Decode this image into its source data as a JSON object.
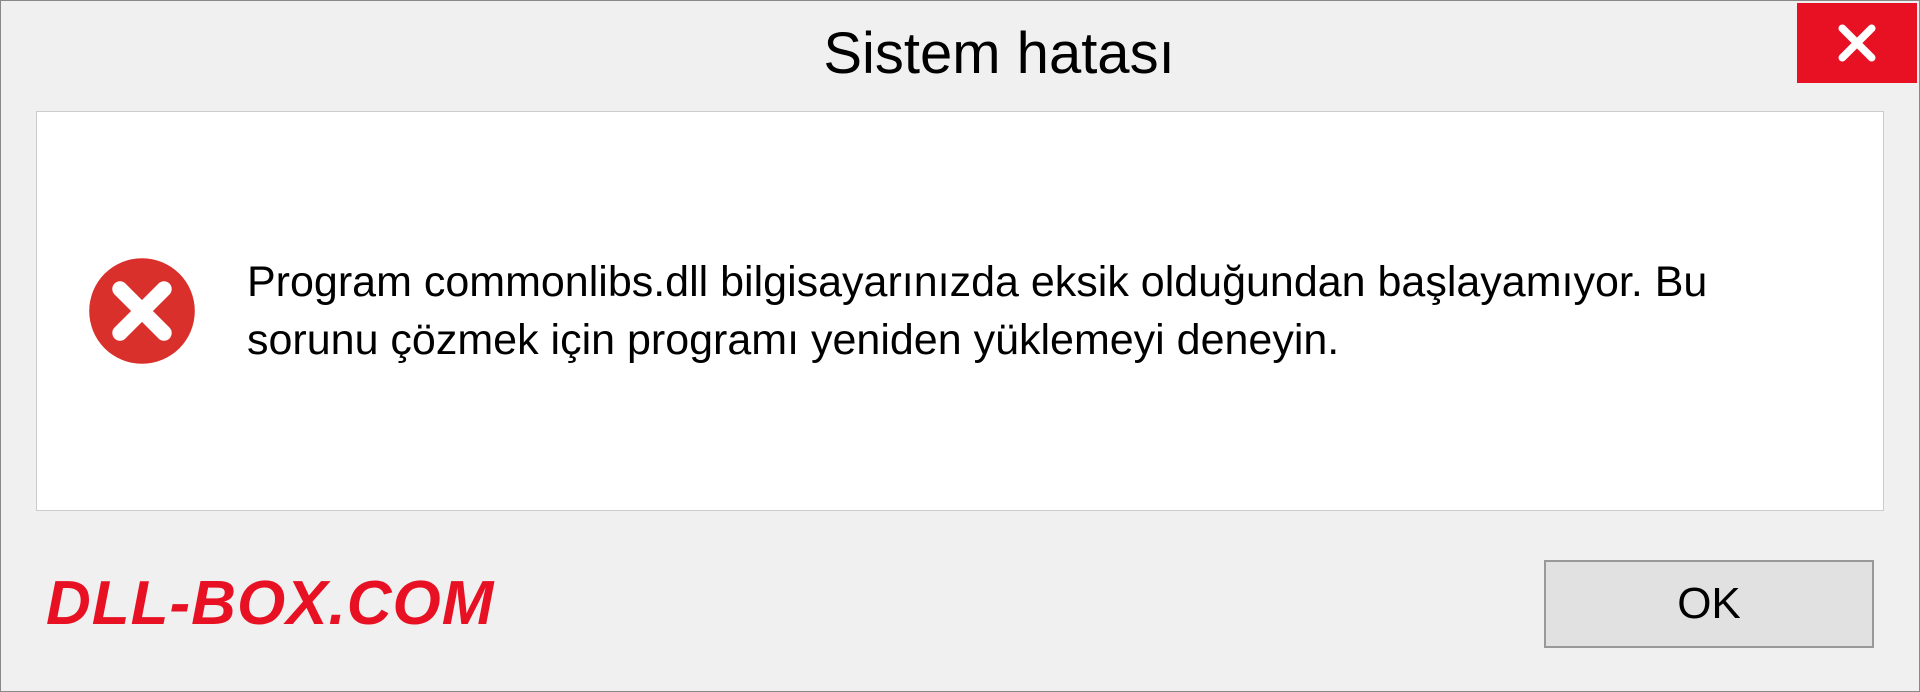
{
  "dialog": {
    "title": "Sistem hatası",
    "message": "Program commonlibs.dll bilgisayarınızda eksik olduğundan başlayamıyor. Bu sorunu çözmek için programı yeniden yüklemeyi deneyin.",
    "ok_label": "OK"
  },
  "watermark": "DLL-BOX.COM",
  "colors": {
    "close_bg": "#e81123",
    "error_icon": "#d9302c"
  }
}
